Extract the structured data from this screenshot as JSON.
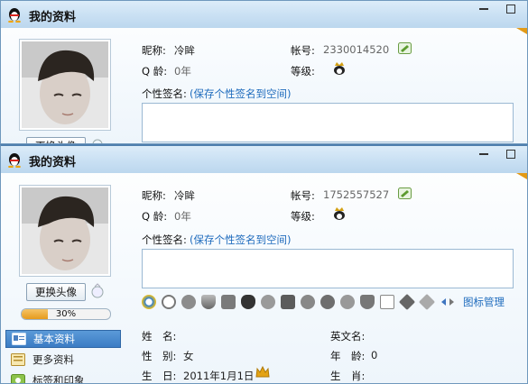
{
  "back_window": {
    "title": "我的资料",
    "nickname_label": "昵称:",
    "nickname": "冷眸",
    "account_label": "帐号:",
    "account": "2330014520",
    "qq_age_label": "Q 龄:",
    "qq_age": "0年",
    "level_label": "等级:",
    "signature_label": "个性签名:",
    "signature_link": "(保存个性签名到空间)",
    "change_avatar_button": "更换头像"
  },
  "front_window": {
    "title": "我的资料",
    "nickname_label": "昵称:",
    "nickname": "冷眸",
    "account_label": "帐号:",
    "account": "1752557527",
    "qq_age_label": "Q 龄:",
    "qq_age": "0年",
    "level_label": "等级:",
    "signature_label": "个性签名:",
    "signature_link": "(保存个性签名到空间)",
    "change_avatar_button": "更换头像",
    "profile_progress": "30%",
    "profile_progress_value": 0.3,
    "icon_manage_link": "图标管理",
    "nav_items": [
      {
        "label": "基本资料",
        "icon": "id-card-icon",
        "active": true
      },
      {
        "label": "更多资料",
        "icon": "more-info-icon",
        "active": false
      },
      {
        "label": "标签和印象",
        "icon": "tag-icon",
        "active": false
      }
    ],
    "fields": {
      "surname_label": "姓　名:",
      "english_name_label": "英文名:",
      "gender_label": "性　别:",
      "gender": "女",
      "age_label": "年　龄:",
      "age": "0",
      "birthday_label": "生　日:",
      "birthday": "2011年1月1日",
      "zodiac_label": "生　肖:"
    }
  },
  "colors": {
    "title_gradient_top": "#dcecf9",
    "link": "#1e6bbd",
    "nav_active": "#3b7cc4",
    "progress": "#e69a1c"
  }
}
